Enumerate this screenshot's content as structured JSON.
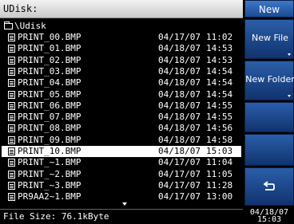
{
  "title": "UDisk:",
  "folder": "\\Udisk",
  "files": [
    {
      "name": "PRINT_00.BMP",
      "date": "04/17/07",
      "time": "11:02"
    },
    {
      "name": "PRINT_01.BMP",
      "date": "04/18/07",
      "time": "14:53"
    },
    {
      "name": "PRINT_02.BMP",
      "date": "04/18/07",
      "time": "14:53"
    },
    {
      "name": "PRINT_03.BMP",
      "date": "04/18/07",
      "time": "14:54"
    },
    {
      "name": "PRINT_04.BMP",
      "date": "04/18/07",
      "time": "14:54"
    },
    {
      "name": "PRINT_05.BMP",
      "date": "04/18/07",
      "time": "14:54"
    },
    {
      "name": "PRINT_06.BMP",
      "date": "04/18/07",
      "time": "14:55"
    },
    {
      "name": "PRINT_07.BMP",
      "date": "04/18/07",
      "time": "14:55"
    },
    {
      "name": "PRINT_08.BMP",
      "date": "04/18/07",
      "time": "14:56"
    },
    {
      "name": "PRINT_09.BMP",
      "date": "04/18/07",
      "time": "14:58"
    },
    {
      "name": "PRINT_10.BMP",
      "date": "04/18/07",
      "time": "15:03"
    },
    {
      "name": "PRINT_~1.BMP",
      "date": "04/17/07",
      "time": "11:04"
    },
    {
      "name": "PRINT_~2.BMP",
      "date": "04/17/07",
      "time": "11:05"
    },
    {
      "name": "PRINT_~3.BMP",
      "date": "04/17/07",
      "time": "11:28"
    },
    {
      "name": "PR9AA2~1.BMP",
      "date": "04/17/07",
      "time": "13:00"
    }
  ],
  "selected_index": 10,
  "status": "File Size: 76.1kByte",
  "softkeys": {
    "top": "New",
    "new_file": "New File",
    "new_folder": "New Folder"
  },
  "clock": {
    "date": "04/18/07",
    "time": "15:03"
  },
  "icons": {
    "back": "return-arrow-icon",
    "file": "file-icon",
    "folder": "folder-icon"
  }
}
